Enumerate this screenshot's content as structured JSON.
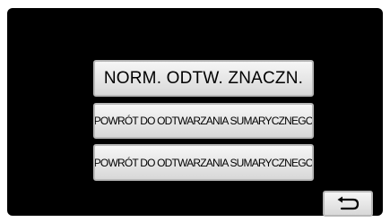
{
  "menu": {
    "items": [
      {
        "label": "NORM. ODTW. ZNACZN."
      },
      {
        "label": "POWRÓT DO ODTWARZANIA SUMARYCZNEGO"
      },
      {
        "label": "POWRÓT DO ODTWARZANIA SUMARYCZNEGO"
      }
    ]
  },
  "back_button": {
    "icon": "return-arrow-icon"
  },
  "colors": {
    "screen_background": "#000000",
    "button_face": "#e6e6e6",
    "button_border": "#b8b8b8"
  }
}
